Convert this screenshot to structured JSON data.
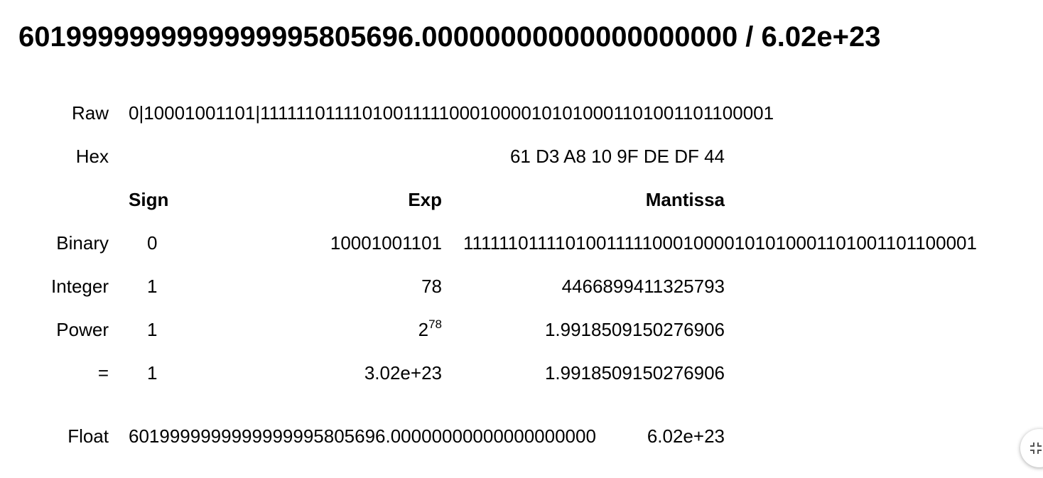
{
  "title": "6019999999999999995805696.00000000000000000000 / 6.02e+23",
  "labels": {
    "raw": "Raw",
    "hex": "Hex",
    "binary": "Binary",
    "integer": "Integer",
    "power": "Power",
    "equals": "=",
    "float": "Float"
  },
  "raw_value": "0|10001001101|1111110111101001111100010000101010001101001101100001",
  "hex_value": "61 D3 A8 10 9F DE DF 44",
  "headers": {
    "sign": "Sign",
    "exp": "Exp",
    "mantissa": "Mantissa"
  },
  "binary": {
    "sign": "0",
    "exp": "10001001101",
    "mantissa": "1111110111101001111100010000101010001101001101100001"
  },
  "integer": {
    "sign": "1",
    "exp": "78",
    "mantissa": "4466899411325793"
  },
  "power": {
    "sign": "1",
    "exp_base": "2",
    "exp_power": "78",
    "mantissa": "1.9918509150276906"
  },
  "equals": {
    "sign": "1",
    "exp": "3.02e+23",
    "mantissa": "1.9918509150276906"
  },
  "float": {
    "decimal": "6019999999999999995805696.00000000000000000000",
    "scientific": "6.02e+23"
  },
  "fab": {
    "icon": "collapse-icon"
  }
}
